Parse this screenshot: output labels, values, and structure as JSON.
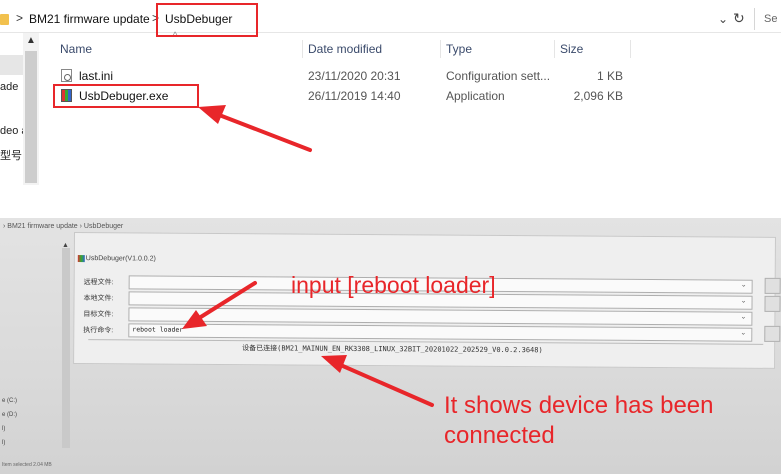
{
  "top": {
    "breadcrumbs": [
      "BM21 firmware update",
      "UsbDebuger"
    ],
    "sep": ">",
    "search_hint": "Se",
    "left_fragments": [
      "ade",
      "deo a",
      "型号"
    ],
    "columns": [
      "Name",
      "Date modified",
      "Type",
      "Size"
    ],
    "files": [
      {
        "name": "last.ini",
        "date": "23/11/2020 20:31",
        "type": "Configuration sett...",
        "size": "1 KB",
        "icon": "ini-file-icon"
      },
      {
        "name": "UsbDebuger.exe",
        "date": "26/11/2019 14:40",
        "type": "Application",
        "size": "2,096 KB",
        "icon": "exe-app-icon"
      }
    ]
  },
  "bottom": {
    "breadcrumb": "› BM21 firmware update › UsbDebuger",
    "dialog_title": "UsbDebuger(V1.0.0.2)",
    "fields": [
      {
        "label": "远程文件:",
        "value": ""
      },
      {
        "label": "本地文件:",
        "value": ""
      },
      {
        "label": "目标文件:",
        "value": ""
      },
      {
        "label": "执行命令:",
        "value": "reboot loader"
      }
    ],
    "status": "设备已连接(BM21_MAINUN_EN_RK3308_LINUX_32BIT_20201022_202529_V0.0.2.3648)",
    "drives": [
      "e (C:)",
      "e (D:)",
      "l)",
      "l)"
    ],
    "status_bar": "Item selected  2.04 MB",
    "annotations": {
      "input_hint": "input [reboot loader]",
      "connected_line1": "It shows device has been",
      "connected_line2": "connected"
    }
  },
  "colors": {
    "highlight_red": "#e8262a"
  }
}
